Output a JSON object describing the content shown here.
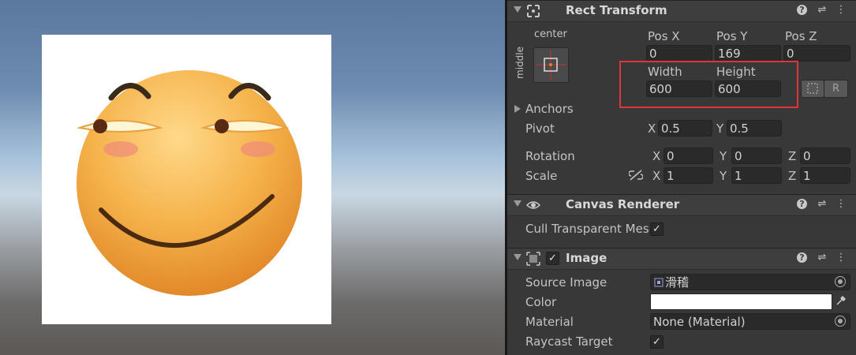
{
  "rect_transform": {
    "title": "Rect Transform",
    "anchor_preset_h": "center",
    "anchor_preset_v": "middle",
    "pos_x_label": "Pos X",
    "pos_y_label": "Pos Y",
    "pos_z_label": "Pos Z",
    "pos_x": "0",
    "pos_y": "169",
    "pos_z": "0",
    "width_label": "Width",
    "height_label": "Height",
    "width": "600",
    "height": "600",
    "raw_button": "R",
    "anchors_label": "Anchors",
    "pivot_label": "Pivot",
    "pivot_x": "0.5",
    "pivot_y": "0.5",
    "rotation_label": "Rotation",
    "rot_x": "0",
    "rot_y": "0",
    "rot_z": "0",
    "scale_label": "Scale",
    "scale_x": "1",
    "scale_y": "1",
    "scale_z": "1",
    "axis_x": "X",
    "axis_y": "Y",
    "axis_z": "Z"
  },
  "canvas_renderer": {
    "title": "Canvas Renderer",
    "cull_label": "Cull Transparent Mes",
    "cull_checked": "✓"
  },
  "image": {
    "title": "Image",
    "enabled_check": "✓",
    "source_image_label": "Source Image",
    "source_image_value": "滑稽",
    "color_label": "Color",
    "color_value": "#ffffff",
    "material_label": "Material",
    "material_value": "None (Material)",
    "raycast_label": "Raycast Target",
    "raycast_checked": "✓"
  },
  "header_icons": [
    "help-icon",
    "settings-sliders-icon",
    "more-menu-icon"
  ],
  "colors": {
    "highlight": "#e03535",
    "inspector_bg": "#383838",
    "field_bg": "#2a2a2a"
  }
}
